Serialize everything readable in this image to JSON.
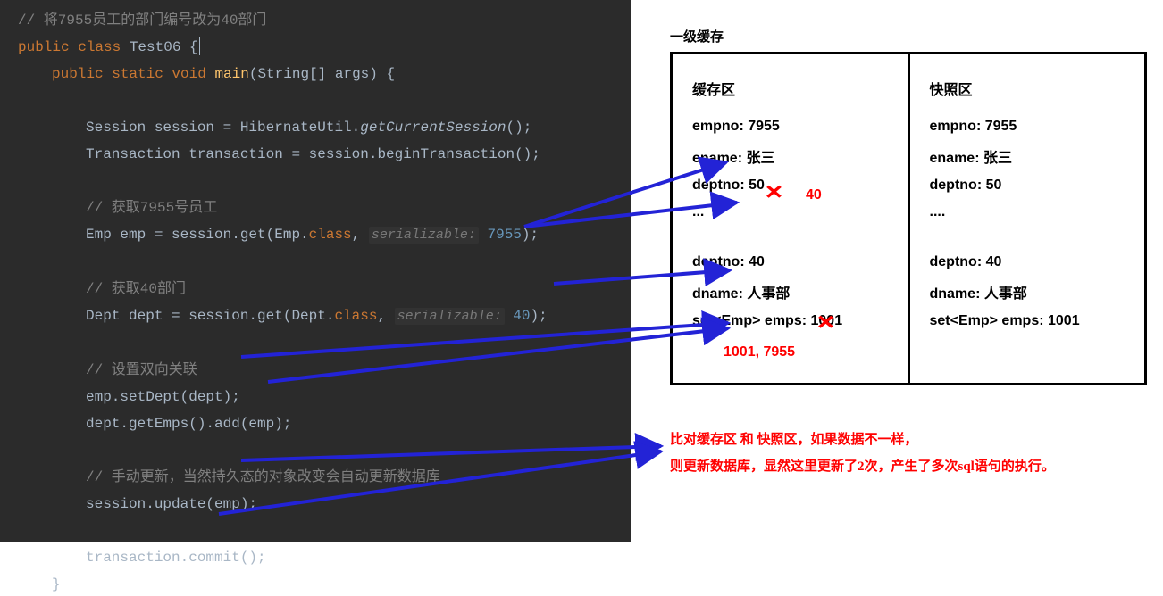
{
  "code": {
    "comment_top": "// 将7955员工的部门编号改为40部门",
    "class_decl": {
      "kw1": "public class ",
      "name": "Test06 ",
      "brace": "{"
    },
    "main_decl": {
      "kw": "public static void ",
      "name": "main",
      "params": "(String[] args) {"
    },
    "line_session": "Session session = HibernateUtil.",
    "line_session_call": "getCurrentSession",
    "line_session_end": "();",
    "line_tx": "Transaction transaction = session.beginTransaction();",
    "comment_getemp": "// 获取7955号员工",
    "line_getemp_a": "Emp emp = session.get(Emp.",
    "line_getemp_b": "class",
    "line_getemp_c": ", ",
    "line_getemp_hint": "serializable:",
    "line_getemp_num": " 7955",
    "line_getemp_end": ");",
    "comment_getdept": "// 获取40部门",
    "line_getdept_a": "Dept dept = session.get(Dept.",
    "line_getdept_b": "class",
    "line_getdept_c": ", ",
    "line_getdept_hint": "serializable:",
    "line_getdept_num": " 40",
    "line_getdept_end": ");",
    "comment_setbi": "// 设置双向关联",
    "line_setdept": "emp.setDept(dept);",
    "line_addemps": "dept.getEmps().add(emp);",
    "comment_update": "// 手动更新，当然持久态的对象改变会自动更新数据库",
    "line_update": "session.update(emp);",
    "line_commit": "transaction.commit();",
    "brace_close": "}"
  },
  "diagram": {
    "title": "一级缓存",
    "cache": {
      "title": "缓存区",
      "r1": "empno: 7955",
      "r2": "ename: 张三",
      "r3": "deptno: 50",
      "r4": "...",
      "r5": "deptno: 40",
      "r6": "dname: 人事部",
      "r7": "set<Emp> emps: 1001",
      "red40": "40",
      "red_nums": "1001, 7955"
    },
    "snapshot": {
      "title": "快照区",
      "r1": "empno: 7955",
      "r2": "ename: 张三",
      "r3": "deptno: 50",
      "r4": "....",
      "r5": "deptno: 40",
      "r6": "dname: 人事部",
      "r7": "set<Emp> emps: 1001"
    },
    "explain1": "比对缓存区 和 快照区，如果数据不一样，",
    "explain2": "则更新数据库，显然这里更新了2次，产生了多次sql语句的执行。"
  }
}
